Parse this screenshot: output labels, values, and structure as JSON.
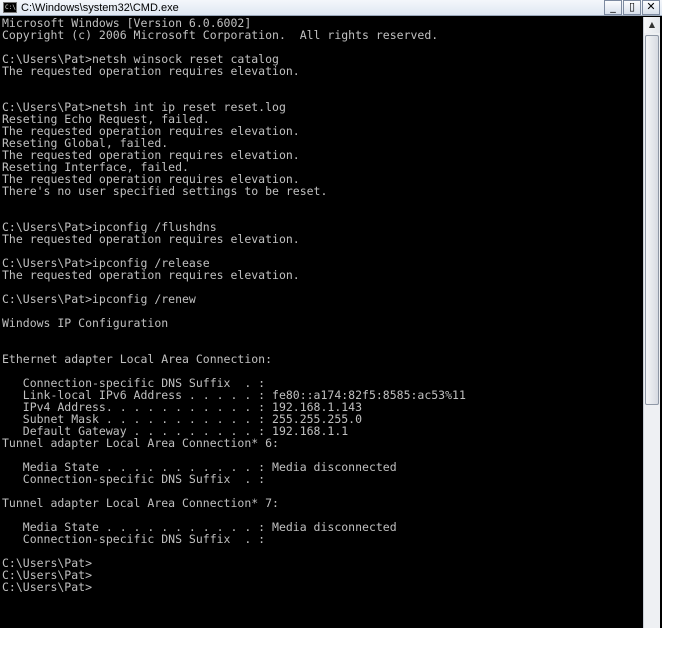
{
  "window": {
    "title": "C:\\Windows\\system32\\CMD.exe",
    "icon_text": "C:\\",
    "buttons": {
      "minimize": "_",
      "maximize": "▯",
      "close": "✕"
    }
  },
  "console": {
    "lines": [
      "Microsoft Windows [Version 6.0.6002]",
      "Copyright (c) 2006 Microsoft Corporation.  All rights reserved.",
      "",
      "C:\\Users\\Pat>netsh winsock reset catalog",
      "The requested operation requires elevation.",
      "",
      "",
      "C:\\Users\\Pat>netsh int ip reset reset.log",
      "Reseting Echo Request, failed.",
      "The requested operation requires elevation.",
      "Reseting Global, failed.",
      "The requested operation requires elevation.",
      "Reseting Interface, failed.",
      "The requested operation requires elevation.",
      "There's no user specified settings to be reset.",
      "",
      "",
      "C:\\Users\\Pat>ipconfig /flushdns",
      "The requested operation requires elevation.",
      "",
      "C:\\Users\\Pat>ipconfig /release",
      "The requested operation requires elevation.",
      "",
      "C:\\Users\\Pat>ipconfig /renew",
      "",
      "Windows IP Configuration",
      "",
      "",
      "Ethernet adapter Local Area Connection:",
      "",
      "   Connection-specific DNS Suffix  . :",
      "   Link-local IPv6 Address . . . . . : fe80::a174:82f5:8585:ac53%11",
      "   IPv4 Address. . . . . . . . . . . : 192.168.1.143",
      "   Subnet Mask . . . . . . . . . . . : 255.255.255.0",
      "   Default Gateway . . . . . . . . . : 192.168.1.1",
      "Tunnel adapter Local Area Connection* 6:",
      "",
      "   Media State . . . . . . . . . . . : Media disconnected",
      "   Connection-specific DNS Suffix  . :",
      "",
      "Tunnel adapter Local Area Connection* 7:",
      "",
      "   Media State . . . . . . . . . . . : Media disconnected",
      "   Connection-specific DNS Suffix  . :",
      "",
      "C:\\Users\\Pat>",
      "C:\\Users\\Pat>",
      "C:\\Users\\Pat>"
    ]
  },
  "scrollbar": {
    "up_arrow": "▲"
  }
}
